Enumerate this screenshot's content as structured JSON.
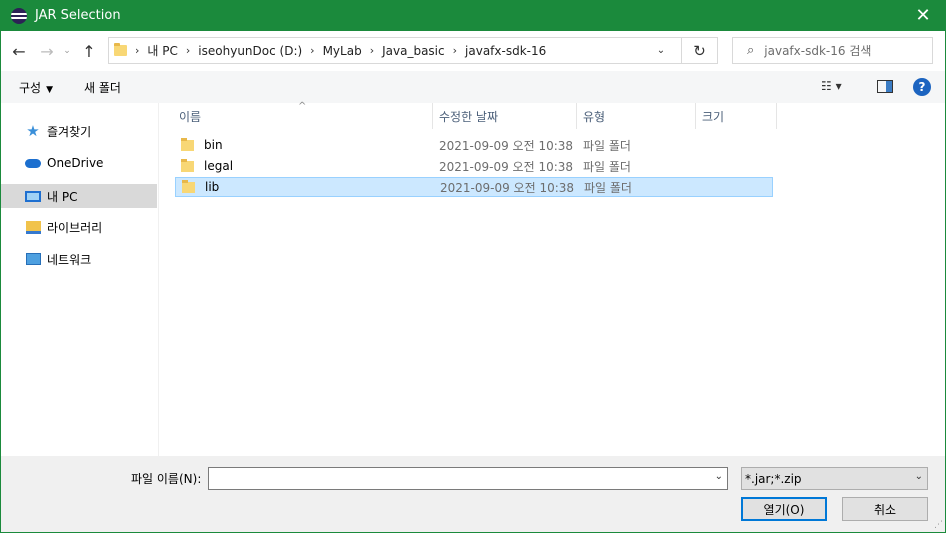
{
  "window": {
    "title": "JAR Selection",
    "close_glyph": "✕"
  },
  "address": {
    "crumbs": [
      "내 PC",
      "iseohyunDoc (D:)",
      "MyLab",
      "Java_basic",
      "javafx-sdk-16"
    ],
    "search_placeholder": "javafx-sdk-16 검색"
  },
  "toolbar": {
    "organize_label": "구성",
    "new_folder_label": "새 폴더"
  },
  "sidebar": {
    "items": [
      {
        "label": "즐겨찾기",
        "icon": "star-icon"
      },
      {
        "label": "OneDrive",
        "icon": "cloud-icon"
      },
      {
        "label": "내 PC",
        "icon": "pc-icon",
        "selected": true
      },
      {
        "label": "라이브러리",
        "icon": "library-icon"
      },
      {
        "label": "네트워크",
        "icon": "network-icon"
      }
    ]
  },
  "columns": {
    "name": "이름",
    "date": "수정한 날짜",
    "type": "유형",
    "size": "크기"
  },
  "files": [
    {
      "name": "bin",
      "date": "2021-09-09 오전 10:38",
      "type": "파일 폴더"
    },
    {
      "name": "legal",
      "date": "2021-09-09 오전 10:38",
      "type": "파일 폴더"
    },
    {
      "name": "lib",
      "date": "2021-09-09 오전 10:38",
      "type": "파일 폴더",
      "selected": true
    }
  ],
  "bottom": {
    "filename_label": "파일 이름(N):",
    "filename_value": "",
    "filter_value": "*.jar;*.zip",
    "open_label": "열기(O)",
    "cancel_label": "취소"
  }
}
